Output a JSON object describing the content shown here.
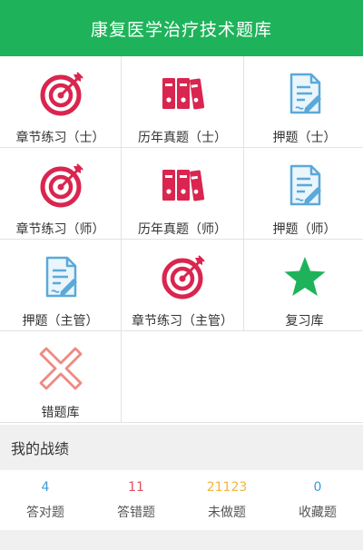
{
  "header": {
    "title": "康复医学治疗技术题库"
  },
  "menu": [
    {
      "label": "章节练习（士）",
      "icon": "target-icon"
    },
    {
      "label": "历年真题（士）",
      "icon": "binders-icon"
    },
    {
      "label": "押题（士）",
      "icon": "document-icon"
    },
    {
      "label": "章节练习（师）",
      "icon": "target-icon"
    },
    {
      "label": "历年真题（师）",
      "icon": "binders-icon"
    },
    {
      "label": "押题（师）",
      "icon": "document-icon"
    },
    {
      "label": "押题（主管）",
      "icon": "document-icon"
    },
    {
      "label": "章节练习（主管）",
      "icon": "target-icon"
    },
    {
      "label": "复习库",
      "icon": "star-icon"
    },
    {
      "label": "错题库",
      "icon": "cross-icon"
    }
  ],
  "record": {
    "title": "我的战绩",
    "stats": [
      {
        "value": "4",
        "label": "答对题",
        "color": "#3a9bd9"
      },
      {
        "value": "11",
        "label": "答错题",
        "color": "#e0505e"
      },
      {
        "value": "21123",
        "label": "未做题",
        "color": "#f2b53c"
      },
      {
        "value": "0",
        "label": "收藏题",
        "color": "#3a9bd9"
      }
    ]
  },
  "colors": {
    "brand": "#1eb35a",
    "target": "#d9254f",
    "binders": "#d9254f",
    "document": "#5aa9d9",
    "star": "#1eb35a",
    "cross": "#ee8a82"
  }
}
